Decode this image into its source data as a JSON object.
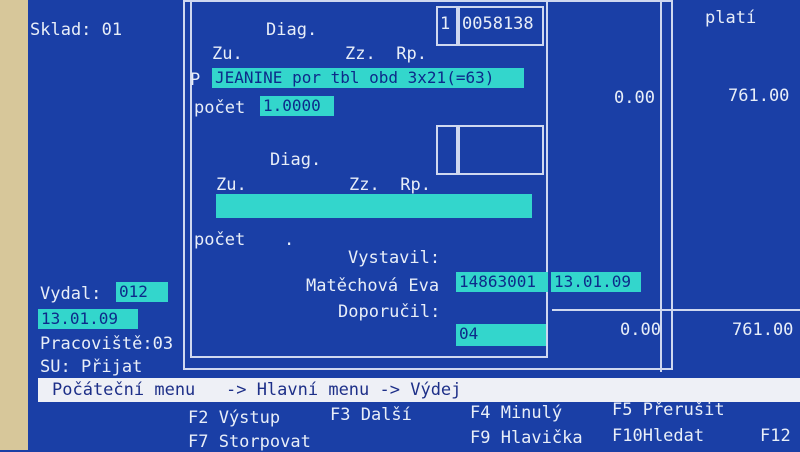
{
  "left_panel": {
    "sklad_label": "Sklad: 01",
    "vydal_label": "Vydal:",
    "vydal_code": "012",
    "vydal_date": "13.01.09",
    "pracoviste": "Pracoviště:03",
    "su": "SU: Přijat"
  },
  "right_panel": {
    "header": "platí",
    "row1_amount": "0.00",
    "row1_total": "761.00",
    "row2_amount": "0.00",
    "row2_total": "761.00"
  },
  "dialog": {
    "line_no": "1",
    "code": "0058138",
    "diag1": "Diag.",
    "cols1": "Zu.          Zz.  Rp.",
    "p_label": "P",
    "product": "JEANINE por tbl obd 3x21(=63)",
    "pocet_label": "počet",
    "pocet_value": "1.0000",
    "diag2": "Diag.",
    "cols2": "Zu.          Zz.  Rp.",
    "product2": "",
    "pocet2_label": "počet",
    "pocet2_value": ".",
    "vystavil_label": "Vystavil:",
    "doctor_name": "Matěchová Eva",
    "doctor_code": "14863001",
    "doctor_date": "13.01.09",
    "doporucil_label": "Doporučil:",
    "doporucil_value": "04"
  },
  "breadcrumb": "Počáteční menu   -> Hlavní menu -> Výdej",
  "fkeys": {
    "f2": "F2 Výstup",
    "f3": "F3 Další",
    "f4": "F4 Minulý",
    "f5": "F5 Přerušit",
    "f7": "F7 Storpovat",
    "f9": "F9 Hlavička",
    "f10": "F10Hledat",
    "f12": "F12"
  },
  "colors": {
    "background": "#1a3fa6",
    "highlight": "#33d6cc",
    "menubar": "#eef0f6"
  }
}
